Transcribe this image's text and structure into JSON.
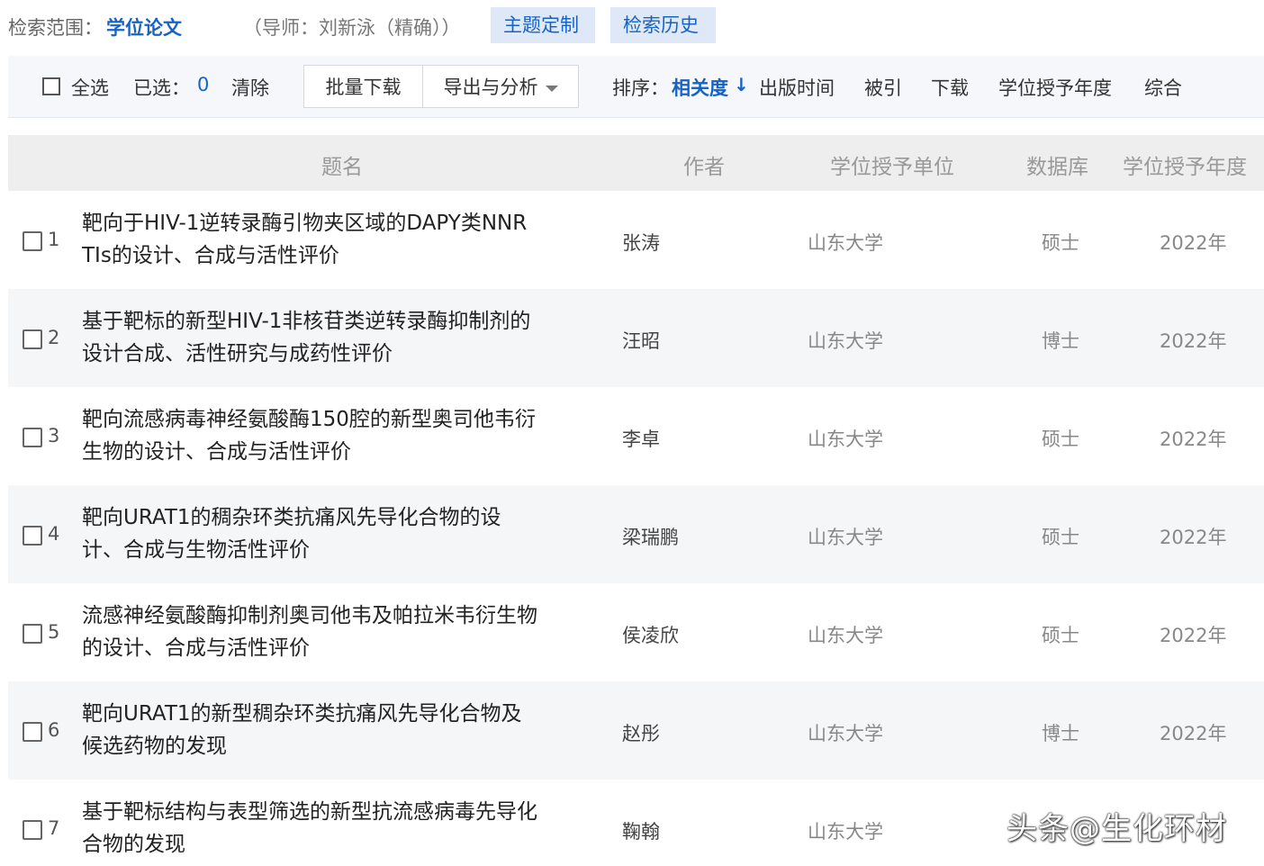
{
  "search_scope": {
    "label": "检索范围：",
    "value": "学位论文",
    "tutor": "（导师：刘新泳（精确））",
    "theme_button": "主题定制",
    "history_button": "检索历史"
  },
  "toolbar": {
    "select_all": "全选",
    "selected_label": "已选：",
    "selected_count": "0",
    "clear": "清除",
    "batch_download": "批量下载",
    "export_analysis": "导出与分析",
    "sort_label": "排序：",
    "sort_active": "相关度",
    "sort_options": [
      "出版时间",
      "被引",
      "下载",
      "学位授予年度",
      "综合"
    ]
  },
  "table": {
    "headers": {
      "title": "题名",
      "author": "作者",
      "unit": "学位授予单位",
      "database": "数据库",
      "year": "学位授予年度"
    },
    "rows": [
      {
        "num": "1",
        "title_l1": "靶向于HIV-1逆转录酶引物夹区域的DAPY类NNR",
        "title_l2": "TIs的设计、合成与活性评价",
        "author": "张涛",
        "unit": "山东大学",
        "database": "硕士",
        "year": "2022年"
      },
      {
        "num": "2",
        "title_l1": "基于靶标的新型HIV-1非核苷类逆转录酶抑制剂的",
        "title_l2": "设计合成、活性研究与成药性评价",
        "author": "汪昭",
        "unit": "山东大学",
        "database": "博士",
        "year": "2022年"
      },
      {
        "num": "3",
        "title_l1": "靶向流感病毒神经氨酸酶150腔的新型奥司他韦衍",
        "title_l2": "生物的设计、合成与活性评价",
        "author": "李卓",
        "unit": "山东大学",
        "database": "硕士",
        "year": "2022年"
      },
      {
        "num": "4",
        "title_l1": "靶向URAT1的稠杂环类抗痛风先导化合物的设",
        "title_l2": "计、合成与生物活性评价",
        "author": "梁瑞鹏",
        "unit": "山东大学",
        "database": "硕士",
        "year": "2022年"
      },
      {
        "num": "5",
        "title_l1": "流感神经氨酸酶抑制剂奥司他韦及帕拉米韦衍生物",
        "title_l2": "的设计、合成与活性评价",
        "author": "侯凌欣",
        "unit": "山东大学",
        "database": "硕士",
        "year": "2022年"
      },
      {
        "num": "6",
        "title_l1": "靶向URAT1的新型稠杂环类抗痛风先导化合物及",
        "title_l2": "候选药物的发现",
        "author": "赵彤",
        "unit": "山东大学",
        "database": "博士",
        "year": "2022年"
      },
      {
        "num": "7",
        "title_l1": "基于靶标结构与表型筛选的新型抗流感病毒先导化",
        "title_l2": "合物的发现",
        "author": "鞠翰",
        "unit": "山东大学",
        "database": "",
        "year": ""
      }
    ]
  },
  "watermark": "头条@生化环材"
}
